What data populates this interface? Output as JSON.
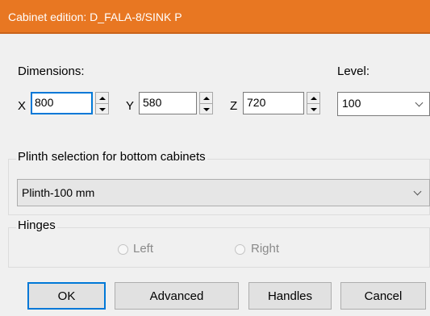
{
  "window": {
    "title": "Cabinet edition: D_FALA-8/SINK P"
  },
  "dimensions": {
    "label": "Dimensions:",
    "x": {
      "axis": "X",
      "value": "800"
    },
    "y": {
      "axis": "Y",
      "value": "580"
    },
    "z": {
      "axis": "Z",
      "value": "720"
    }
  },
  "level": {
    "label": "Level:",
    "value": "100"
  },
  "plinth": {
    "group_label": "Plinth selection for bottom cabinets",
    "value": "Plinth-100 mm"
  },
  "hinges": {
    "group_label": "Hinges",
    "left_label": "Left",
    "right_label": "Right"
  },
  "buttons": {
    "ok": "OK",
    "advanced": "Advanced",
    "handles": "Handles",
    "cancel": "Cancel"
  },
  "colors": {
    "titlebar": "#e87722",
    "accent": "#0078d7"
  }
}
